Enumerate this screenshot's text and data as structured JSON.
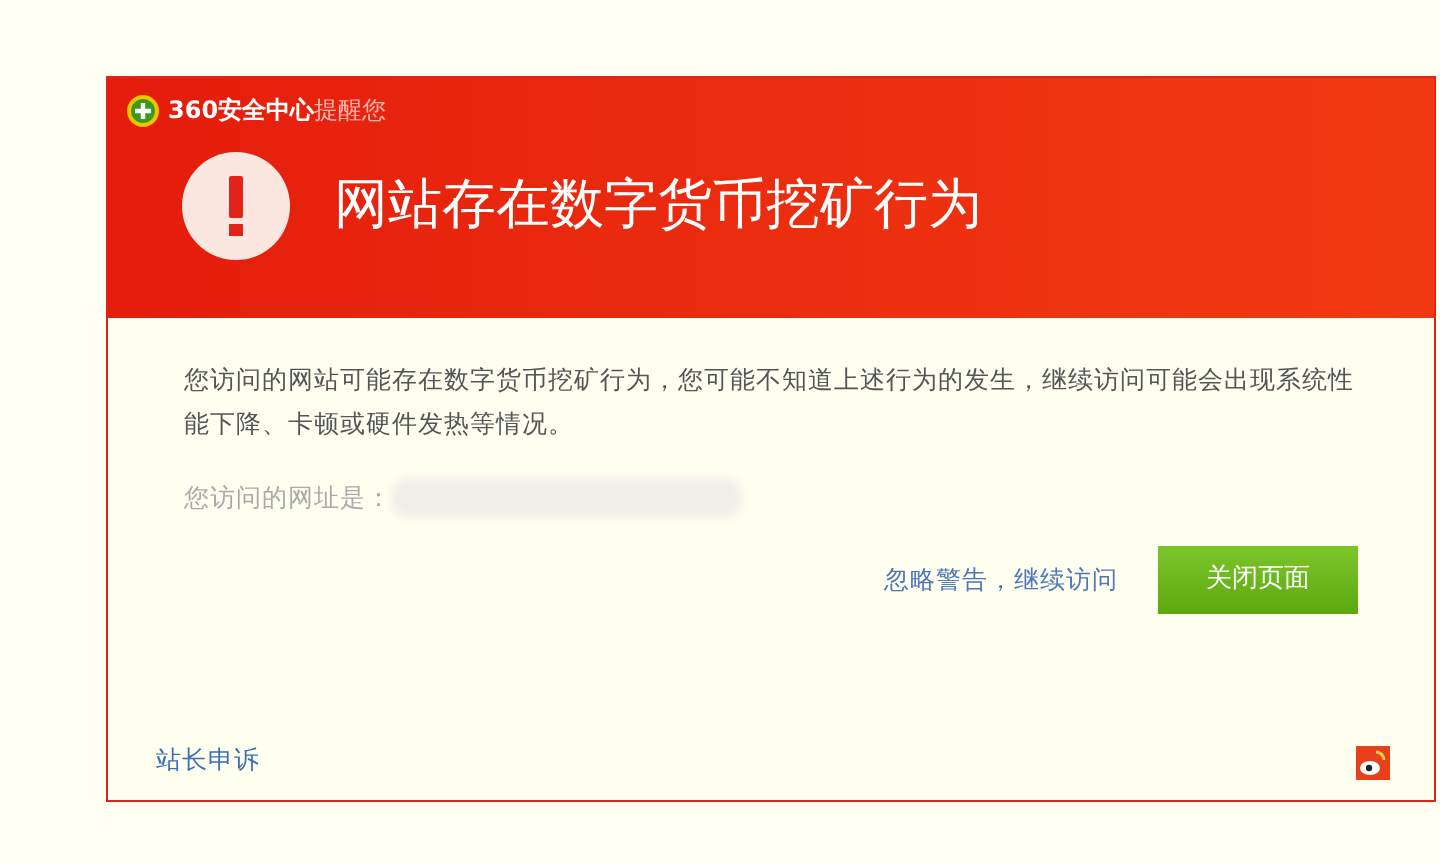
{
  "header": {
    "brand": "360安全中心",
    "brand_suffix": "提醒您",
    "title": "网站存在数字货币挖矿行为"
  },
  "body": {
    "message": "您访问的网站可能存在数字货币挖矿行为，您可能不知道上述行为的发生，继续访问可能会出现系统性能下降、卡顿或硬件发热等情况。",
    "url_label": "您访问的网址是："
  },
  "actions": {
    "ignore_link": "忽略警告，继续访问",
    "close_button": "关闭页面"
  },
  "footer": {
    "appeal_link": "站长申诉"
  }
}
